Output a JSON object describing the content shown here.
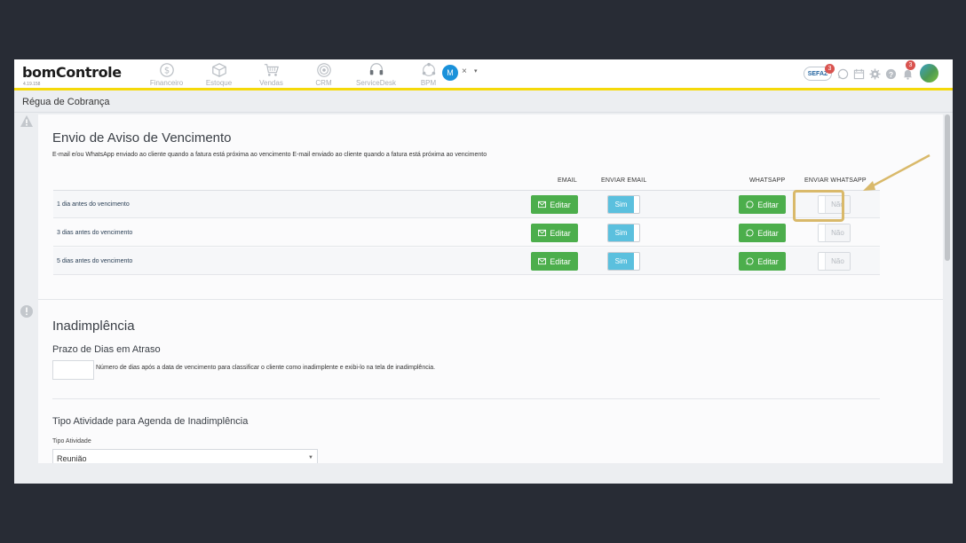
{
  "app": {
    "logo": "bomControle",
    "version": "4.19.158"
  },
  "modules": [
    {
      "label": "Financeiro",
      "icon": "dollar-icon"
    },
    {
      "label": "Estoque",
      "icon": "box-icon"
    },
    {
      "label": "Vendas",
      "icon": "cart-icon"
    },
    {
      "label": "CRM",
      "icon": "target-icon"
    },
    {
      "label": "ServiceDesk",
      "icon": "headset-icon"
    },
    {
      "label": "BPM",
      "icon": "flow-icon"
    }
  ],
  "user": {
    "initial": "M",
    "close": "×",
    "caret": "▾"
  },
  "toolbar": {
    "sefaz_label": "SEFAZ",
    "sefaz_badge": "3",
    "notifications_badge": "3"
  },
  "page": {
    "title": "Régua de Cobrança"
  },
  "aviso": {
    "title": "Envio de Aviso de Vencimento",
    "description": "E-mail e/ou WhatsApp enviado ao cliente quando a fatura está próxima ao vencimento E-mail enviado ao cliente quando a fatura está próxima ao vencimento",
    "headers": {
      "email": "EMAIL",
      "enviar_email": "ENVIAR EMAIL",
      "whatsapp": "WHATSAPP",
      "enviar_whatsapp": "ENVIAR WHATSAPP"
    },
    "rows": [
      {
        "label": "1 dia antes do vencimento",
        "email_btn": "Editar",
        "enviar_email": "Sim",
        "whatsapp_btn": "Editar",
        "enviar_whatsapp": "Não"
      },
      {
        "label": "3 dias antes do vencimento",
        "email_btn": "Editar",
        "enviar_email": "Sim",
        "whatsapp_btn": "Editar",
        "enviar_whatsapp": "Não"
      },
      {
        "label": "5 dias antes do vencimento",
        "email_btn": "Editar",
        "enviar_email": "Sim",
        "whatsapp_btn": "Editar",
        "enviar_whatsapp": "Não"
      }
    ]
  },
  "inadimplencia": {
    "title": "Inadimplência",
    "prazo_title": "Prazo de Dias em Atraso",
    "prazo_value": "",
    "prazo_help": "Número de dias após a data de vencimento para classificar o cliente como inadimplente e exibi-lo na tela de inadimplência.",
    "tipo_title": "Tipo Atividade para Agenda de Inadimplência",
    "tipo_label": "Tipo Atividade",
    "tipo_value": "Reunião"
  },
  "colors": {
    "accent_yellow": "#f5d90a",
    "edit_green": "#4cae4c",
    "toggle_blue": "#5bc0de",
    "highlight": "#d9b96a"
  }
}
